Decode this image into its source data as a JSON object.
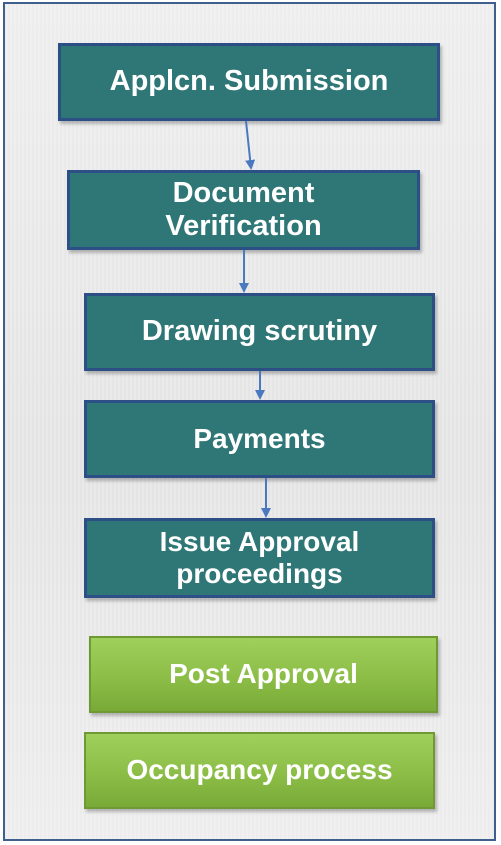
{
  "steps": [
    {
      "label": "Applcn. Submission"
    },
    {
      "label_lines": [
        "Document",
        "Verification"
      ]
    },
    {
      "label": "Drawing scrutiny"
    },
    {
      "label": "Payments"
    },
    {
      "label_lines": [
        "Issue Approval",
        "proceedings"
      ]
    }
  ],
  "post_steps": [
    {
      "label": "Post Approval"
    },
    {
      "label": "Occupancy process"
    }
  ],
  "colors": {
    "step_fill": "#2f7676",
    "step_border": "#2c4f86",
    "post_fill": "#8bbd47",
    "arrow": "#4a79c0",
    "frame_border": "#3f5f8c"
  }
}
